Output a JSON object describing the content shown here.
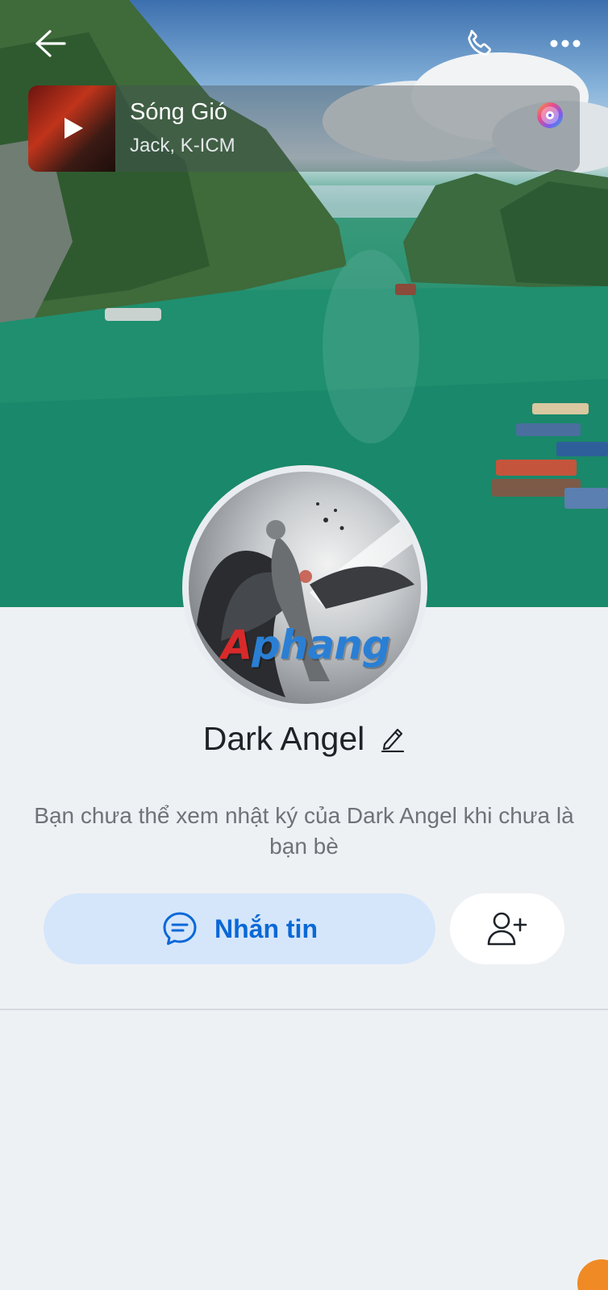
{
  "header": {
    "back_icon": "arrow-left-icon",
    "call_icon": "phone-icon",
    "more_icon": "more-horizontal-icon"
  },
  "music": {
    "title": "Sóng Gió",
    "artist": "Jack, K-ICM",
    "play_icon": "play-icon",
    "disc_icon": "music-disc-icon"
  },
  "avatar": {
    "watermark_text": "Aphang"
  },
  "profile": {
    "name": "Dark Angel",
    "edit_icon": "pencil-icon"
  },
  "notice": "Bạn chưa thể xem nhật ký của Dark Angel khi chưa là bạn bè",
  "actions": {
    "message_label": "Nhắn tin",
    "message_icon": "chat-bubble-icon",
    "add_friend_icon": "add-user-icon"
  },
  "colors": {
    "accent": "#0a68d6",
    "message_button_bg": "#d5e6fb",
    "page_bg": "#eef1f4"
  }
}
